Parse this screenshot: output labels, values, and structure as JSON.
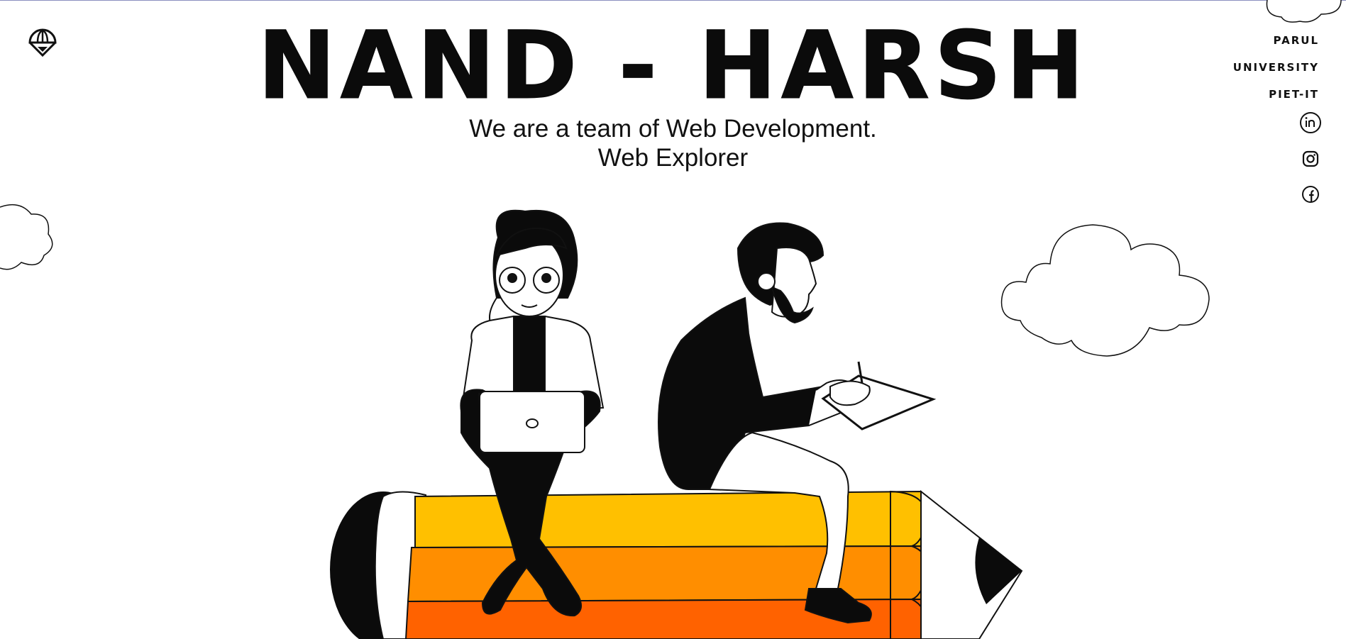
{
  "header": {
    "title": "NAND - HARSH",
    "subtitle_line1": "We are a team of Web Development.",
    "subtitle_line2": "Web Explorer"
  },
  "nav": {
    "items": [
      {
        "label": "PARUL"
      },
      {
        "label": "UNIVERSITY"
      },
      {
        "label": "PIET-IT"
      }
    ]
  },
  "social": [
    {
      "icon": "linkedin-icon"
    },
    {
      "icon": "instagram-icon"
    },
    {
      "icon": "facebook-icon"
    }
  ],
  "colors": {
    "pencil_yellow": "#FFC000",
    "pencil_orange": "#FF8E00",
    "pencil_dark_orange": "#FF6200",
    "ink": "#0B0B0B",
    "background": "#FFFFFF"
  }
}
